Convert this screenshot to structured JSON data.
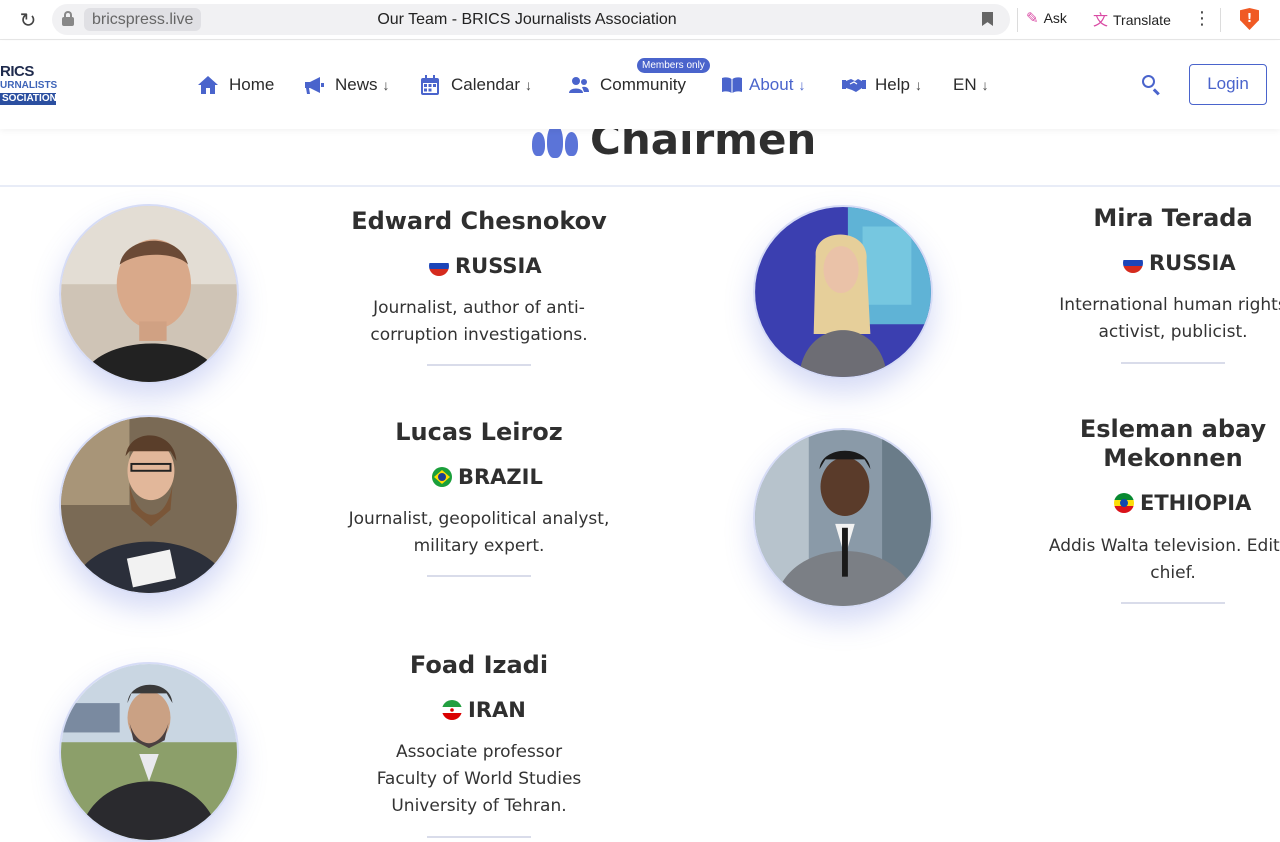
{
  "browser": {
    "domain": "bricspress.live",
    "tab_title": "Our Team - BRICS Journalists Association",
    "ask_label": "Ask",
    "translate_label": "Translate"
  },
  "site": {
    "logo": {
      "line1": "RICS",
      "line2": "URNALISTS",
      "line3": "SOCIATION"
    },
    "nav": [
      {
        "label": "Home",
        "icon": "home-icon"
      },
      {
        "label": "News",
        "icon": "megaphone-icon"
      },
      {
        "label": "Calendar",
        "icon": "calendar-icon"
      },
      {
        "label": "Community",
        "icon": "users-icon",
        "badge": "Members only"
      },
      {
        "label": "About",
        "icon": "book-icon",
        "active": true
      },
      {
        "label": "Help",
        "icon": "handshake-icon"
      },
      {
        "label": "EN"
      }
    ],
    "dropdown_arrow": "↓",
    "login_label": "Login",
    "accent_color": "#4a64cc"
  },
  "section": {
    "title": "Chairmen",
    "icon": "group-icon"
  },
  "members": [
    {
      "name": "Edward Chesnokov",
      "country": "RUSSIA",
      "flag": "russia",
      "description": [
        "Journalist, author of anti-",
        "corruption investigations."
      ]
    },
    {
      "name": "Mira Terada",
      "country": "RUSSIA",
      "flag": "russia",
      "description": [
        "International human rights",
        "activist, publicist."
      ]
    },
    {
      "name": "Lucas Leiroz",
      "country": "BRAZIL",
      "flag": "brazil",
      "description": [
        "Journalist, geopolitical analyst,",
        "military expert."
      ]
    },
    {
      "name_lines": [
        "Esleman abay",
        "Mekonnen"
      ],
      "country": "ETHIOPIA",
      "flag": "ethiopia",
      "description": [
        "Addis Walta television. Editor",
        "chief."
      ]
    },
    {
      "name": "Foad Izadi",
      "country": "IRAN",
      "flag": "iran",
      "description": [
        "Associate professor",
        "Faculty of World Studies",
        "University of Tehran."
      ]
    }
  ]
}
